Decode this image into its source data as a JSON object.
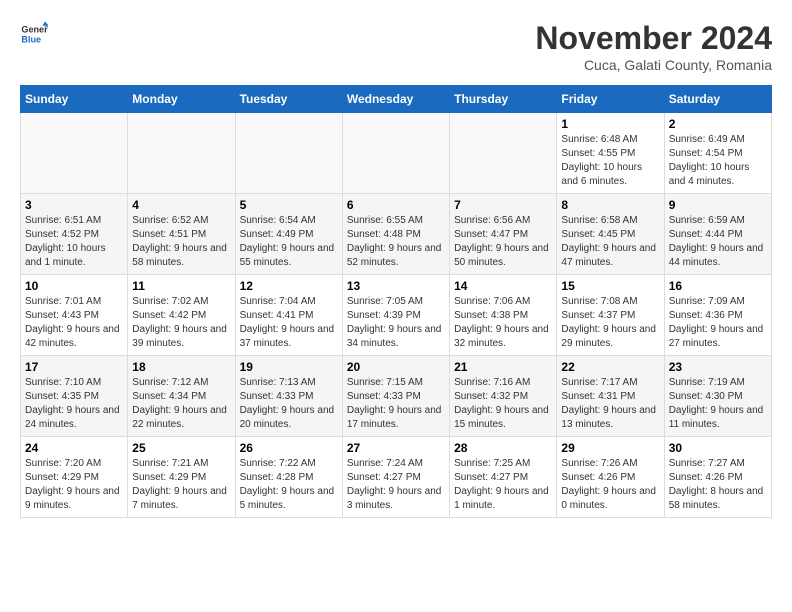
{
  "logo": {
    "general": "General",
    "blue": "Blue"
  },
  "title": "November 2024",
  "subtitle": "Cuca, Galati County, Romania",
  "weekdays": [
    "Sunday",
    "Monday",
    "Tuesday",
    "Wednesday",
    "Thursday",
    "Friday",
    "Saturday"
  ],
  "weeks": [
    [
      {
        "day": "",
        "info": ""
      },
      {
        "day": "",
        "info": ""
      },
      {
        "day": "",
        "info": ""
      },
      {
        "day": "",
        "info": ""
      },
      {
        "day": "",
        "info": ""
      },
      {
        "day": "1",
        "info": "Sunrise: 6:48 AM\nSunset: 4:55 PM\nDaylight: 10 hours and 6 minutes."
      },
      {
        "day": "2",
        "info": "Sunrise: 6:49 AM\nSunset: 4:54 PM\nDaylight: 10 hours and 4 minutes."
      }
    ],
    [
      {
        "day": "3",
        "info": "Sunrise: 6:51 AM\nSunset: 4:52 PM\nDaylight: 10 hours and 1 minute."
      },
      {
        "day": "4",
        "info": "Sunrise: 6:52 AM\nSunset: 4:51 PM\nDaylight: 9 hours and 58 minutes."
      },
      {
        "day": "5",
        "info": "Sunrise: 6:54 AM\nSunset: 4:49 PM\nDaylight: 9 hours and 55 minutes."
      },
      {
        "day": "6",
        "info": "Sunrise: 6:55 AM\nSunset: 4:48 PM\nDaylight: 9 hours and 52 minutes."
      },
      {
        "day": "7",
        "info": "Sunrise: 6:56 AM\nSunset: 4:47 PM\nDaylight: 9 hours and 50 minutes."
      },
      {
        "day": "8",
        "info": "Sunrise: 6:58 AM\nSunset: 4:45 PM\nDaylight: 9 hours and 47 minutes."
      },
      {
        "day": "9",
        "info": "Sunrise: 6:59 AM\nSunset: 4:44 PM\nDaylight: 9 hours and 44 minutes."
      }
    ],
    [
      {
        "day": "10",
        "info": "Sunrise: 7:01 AM\nSunset: 4:43 PM\nDaylight: 9 hours and 42 minutes."
      },
      {
        "day": "11",
        "info": "Sunrise: 7:02 AM\nSunset: 4:42 PM\nDaylight: 9 hours and 39 minutes."
      },
      {
        "day": "12",
        "info": "Sunrise: 7:04 AM\nSunset: 4:41 PM\nDaylight: 9 hours and 37 minutes."
      },
      {
        "day": "13",
        "info": "Sunrise: 7:05 AM\nSunset: 4:39 PM\nDaylight: 9 hours and 34 minutes."
      },
      {
        "day": "14",
        "info": "Sunrise: 7:06 AM\nSunset: 4:38 PM\nDaylight: 9 hours and 32 minutes."
      },
      {
        "day": "15",
        "info": "Sunrise: 7:08 AM\nSunset: 4:37 PM\nDaylight: 9 hours and 29 minutes."
      },
      {
        "day": "16",
        "info": "Sunrise: 7:09 AM\nSunset: 4:36 PM\nDaylight: 9 hours and 27 minutes."
      }
    ],
    [
      {
        "day": "17",
        "info": "Sunrise: 7:10 AM\nSunset: 4:35 PM\nDaylight: 9 hours and 24 minutes."
      },
      {
        "day": "18",
        "info": "Sunrise: 7:12 AM\nSunset: 4:34 PM\nDaylight: 9 hours and 22 minutes."
      },
      {
        "day": "19",
        "info": "Sunrise: 7:13 AM\nSunset: 4:33 PM\nDaylight: 9 hours and 20 minutes."
      },
      {
        "day": "20",
        "info": "Sunrise: 7:15 AM\nSunset: 4:33 PM\nDaylight: 9 hours and 17 minutes."
      },
      {
        "day": "21",
        "info": "Sunrise: 7:16 AM\nSunset: 4:32 PM\nDaylight: 9 hours and 15 minutes."
      },
      {
        "day": "22",
        "info": "Sunrise: 7:17 AM\nSunset: 4:31 PM\nDaylight: 9 hours and 13 minutes."
      },
      {
        "day": "23",
        "info": "Sunrise: 7:19 AM\nSunset: 4:30 PM\nDaylight: 9 hours and 11 minutes."
      }
    ],
    [
      {
        "day": "24",
        "info": "Sunrise: 7:20 AM\nSunset: 4:29 PM\nDaylight: 9 hours and 9 minutes."
      },
      {
        "day": "25",
        "info": "Sunrise: 7:21 AM\nSunset: 4:29 PM\nDaylight: 9 hours and 7 minutes."
      },
      {
        "day": "26",
        "info": "Sunrise: 7:22 AM\nSunset: 4:28 PM\nDaylight: 9 hours and 5 minutes."
      },
      {
        "day": "27",
        "info": "Sunrise: 7:24 AM\nSunset: 4:27 PM\nDaylight: 9 hours and 3 minutes."
      },
      {
        "day": "28",
        "info": "Sunrise: 7:25 AM\nSunset: 4:27 PM\nDaylight: 9 hours and 1 minute."
      },
      {
        "day": "29",
        "info": "Sunrise: 7:26 AM\nSunset: 4:26 PM\nDaylight: 9 hours and 0 minutes."
      },
      {
        "day": "30",
        "info": "Sunrise: 7:27 AM\nSunset: 4:26 PM\nDaylight: 8 hours and 58 minutes."
      }
    ]
  ]
}
